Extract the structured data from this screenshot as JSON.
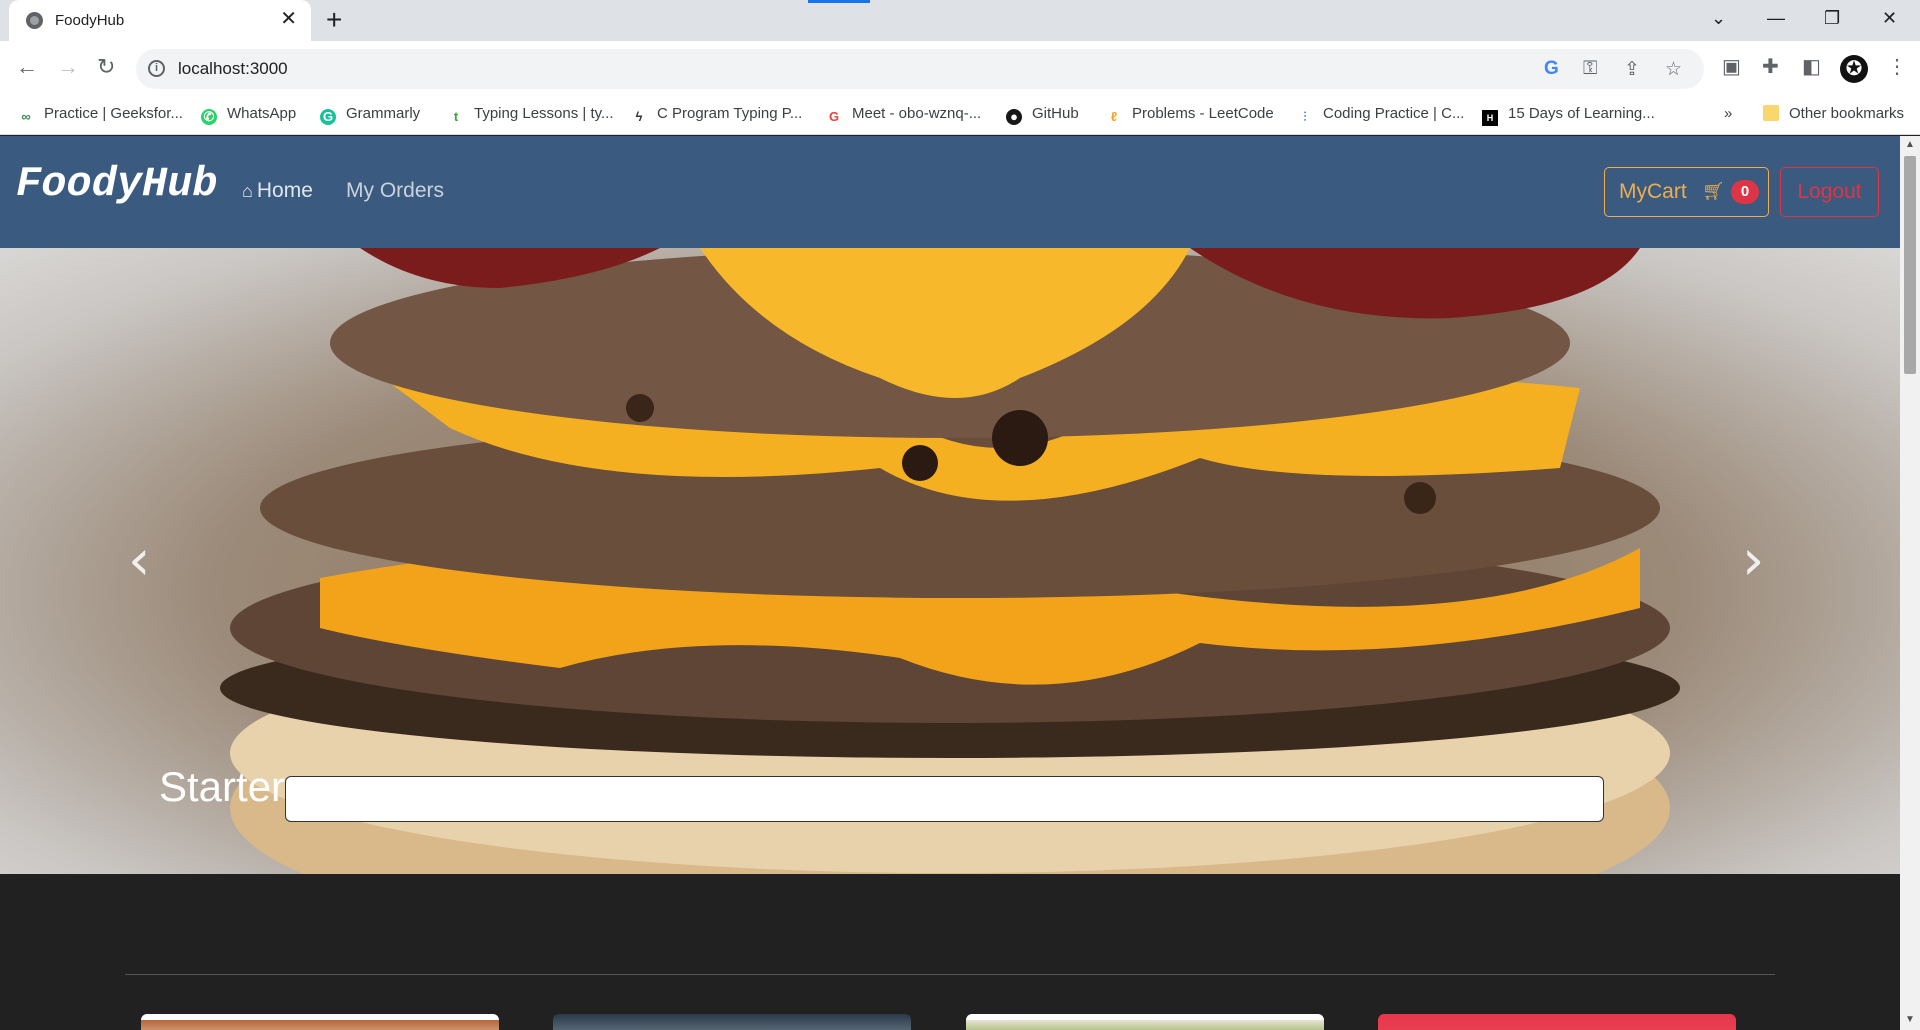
{
  "browser": {
    "tab_title": "FoodyHub",
    "tab_close": "✕",
    "new_tab": "+",
    "url": "localhost:3000",
    "bookmarks": [
      {
        "label": "Practice | Geeksfor...",
        "icon": "geeksforgeeks-icon"
      },
      {
        "label": "WhatsApp",
        "icon": "whatsapp-icon"
      },
      {
        "label": "Grammarly",
        "icon": "grammarly-icon"
      },
      {
        "label": "Typing Lessons | ty...",
        "icon": "typing-icon"
      },
      {
        "label": "C Program Typing P...",
        "icon": "lightning-icon"
      },
      {
        "label": "Meet - obo-wznq-...",
        "icon": "google-icon"
      },
      {
        "label": "GitHub",
        "icon": "github-icon"
      },
      {
        "label": "Problems - LeetCode",
        "icon": "leetcode-icon"
      },
      {
        "label": "Coding Practice | C...",
        "icon": "chart-icon"
      },
      {
        "label": "15 Days of Learning...",
        "icon": "hackerrank-icon"
      }
    ],
    "bookmarks_overflow": "»",
    "other_bookmarks": "Other bookmarks"
  },
  "app": {
    "brand": "FoodyHub",
    "nav": {
      "home": "Home",
      "orders": "My Orders"
    },
    "cart_label": "MyCart",
    "cart_count": "0",
    "logout": "Logout",
    "search": {
      "value": "",
      "placeholder": ""
    },
    "carousel_prev": "‹",
    "carousel_next": "›",
    "section_title": "Starter"
  },
  "colors": {
    "navbar": "#3a5a80",
    "accent_warning": "#f0ad4e",
    "accent_danger": "#dc3545",
    "page_bg": "#212121"
  }
}
